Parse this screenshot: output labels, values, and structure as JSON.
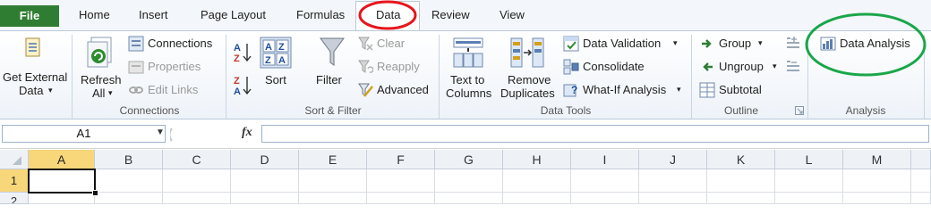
{
  "tabs": {
    "file": "File",
    "home": "Home",
    "insert": "Insert",
    "page_layout": "Page Layout",
    "formulas": "Formulas",
    "data": "Data",
    "review": "Review",
    "view": "View"
  },
  "ribbon": {
    "get_external": {
      "line1": "Get External",
      "line2": "Data"
    },
    "connections": {
      "refresh_line1": "Refresh",
      "refresh_line2": "All",
      "connections": "Connections",
      "properties": "Properties",
      "edit_links": "Edit Links",
      "group_label": "Connections"
    },
    "sort_filter": {
      "sort": "Sort",
      "filter": "Filter",
      "clear": "Clear",
      "reapply": "Reapply",
      "advanced": "Advanced",
      "group_label": "Sort & Filter"
    },
    "data_tools": {
      "text_to_line1": "Text to",
      "text_to_line2": "Columns",
      "remove_line1": "Remove",
      "remove_line2": "Duplicates",
      "data_validation": "Data Validation",
      "consolidate": "Consolidate",
      "what_if": "What-If Analysis",
      "group_label": "Data Tools"
    },
    "outline": {
      "group": "Group",
      "ungroup": "Ungroup",
      "subtotal": "Subtotal",
      "group_label": "Outline"
    },
    "analysis": {
      "data_analysis": "Data Analysis",
      "group_label": "Analysis"
    }
  },
  "formula_bar": {
    "name_box": "A1",
    "fx": "fx",
    "formula": ""
  },
  "sheet": {
    "columns": [
      "A",
      "B",
      "C",
      "D",
      "E",
      "F",
      "G",
      "H",
      "I",
      "J",
      "K",
      "L",
      "M"
    ],
    "rows": [
      "1",
      "2"
    ],
    "selected_cell": "A1"
  },
  "annotations": {
    "data_tab_circle_color": "#e8141b",
    "data_analysis_circle_color": "#1aa64a"
  }
}
